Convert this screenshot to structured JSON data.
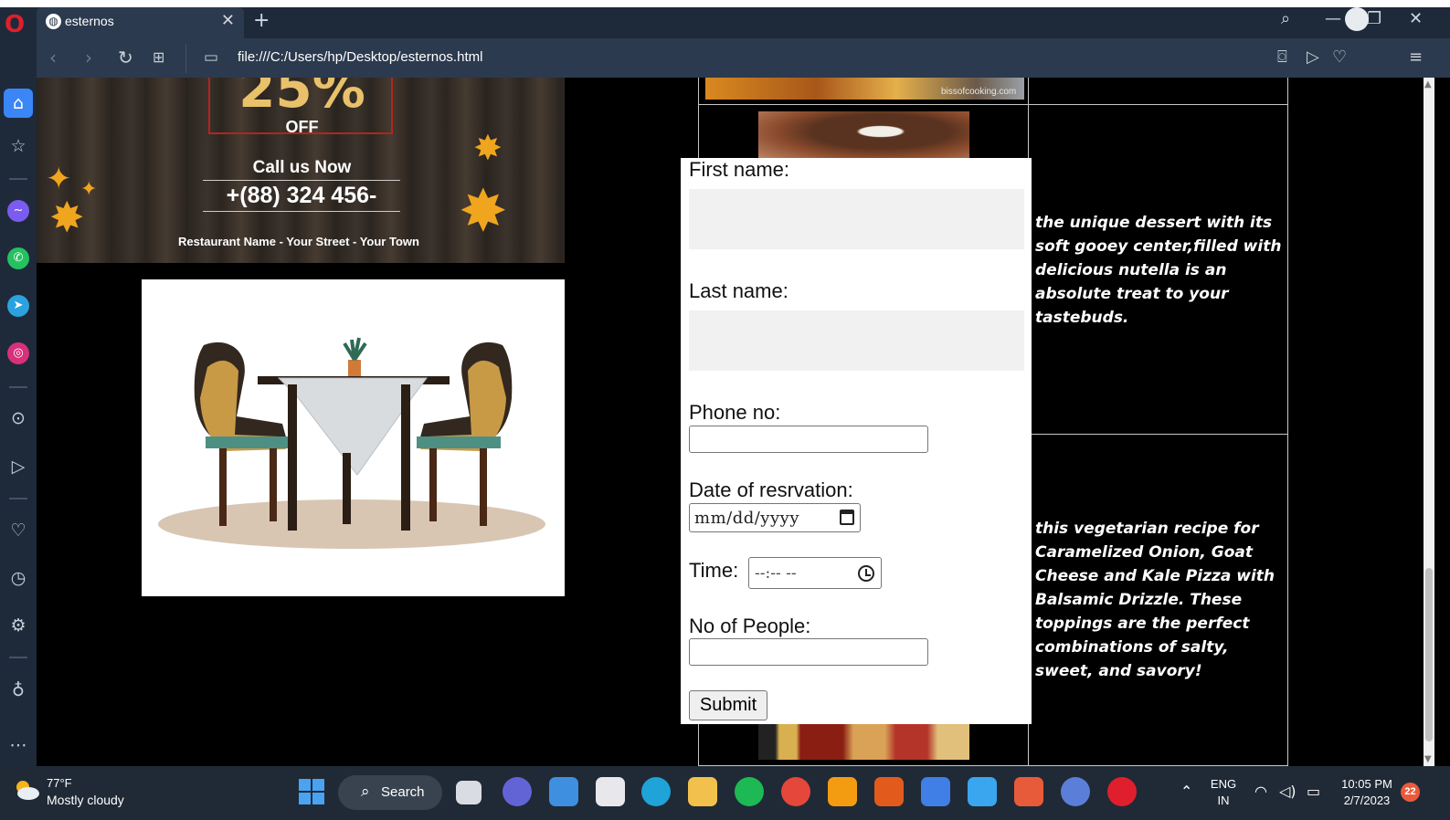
{
  "browser": {
    "tab_title": "esternos",
    "url": "file:///C:/Users/hp/Desktop/esternos.html"
  },
  "banner": {
    "discount": "25%",
    "off": "OFF",
    "call": "Call us Now",
    "phone": "+(88) 324 456-",
    "address": "Restaurant Name - Your Street - Your Town"
  },
  "menu": {
    "desc_1": "the unique dessert with its soft gooey center,filled with delicious nutella is an absolute treat to your tastebuds.",
    "desc_2": "this vegetarian recipe for Caramelized Onion, Goat Cheese and Kale Pizza with Balsamic Drizzle. These toppings are the perfect combinations of salty, sweet, and savory!",
    "image_watermark": "bissofcooking.com"
  },
  "form": {
    "first_name_label": "First name:",
    "last_name_label": "Last name:",
    "phone_label": "Phone no:",
    "date_label": "Date of resrvation:",
    "date_placeholder": "mm/dd/yyyy",
    "time_label": "Time:",
    "time_placeholder": "--:-- --",
    "people_label": "No of People:",
    "submit_label": "Submit"
  },
  "taskbar": {
    "weather_temp": "77°F",
    "weather_desc": "Mostly cloudy",
    "search_label": "Search",
    "lang_line1": "ENG",
    "lang_line2": "IN",
    "time": "10:05 PM",
    "date": "2/7/2023",
    "notification_count": "22"
  },
  "colors": {
    "accent": "#3b86f7",
    "opera_red": "#e01f2c",
    "chrome_bg": "#2b3a4e",
    "taskbar_bg": "#202a36"
  }
}
